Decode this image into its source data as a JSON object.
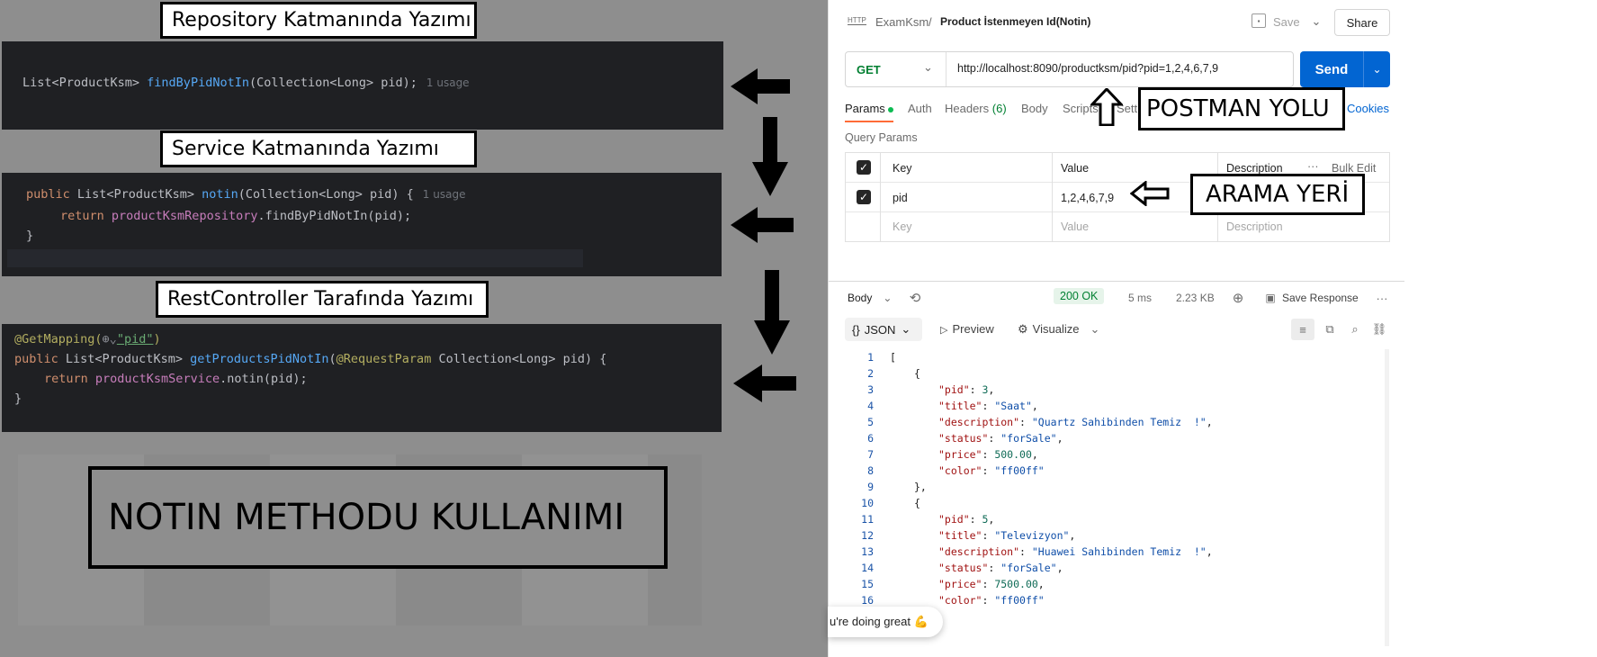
{
  "annotations": {
    "repository_label": "Repository Katmanında Yazımı",
    "service_label": "Service Katmanında Yazımı",
    "controller_label": "RestController Tarafında Yazımı",
    "big_title": "NOTIN METHODU KULLANIMI",
    "postman_yolu": "POSTMAN YOLU",
    "arama_yeri": "ARAMA YERİ"
  },
  "code": {
    "repository": {
      "line1_type": "List<ProductKsm> ",
      "line1_fn": "findByPidNotIn",
      "line1_rest": "(Collection<Long> pid);",
      "usage": "1 usage"
    },
    "service": {
      "line1_kw": "public ",
      "line1_type": "List<ProductKsm> ",
      "line1_fn": "notin",
      "line1_rest": "(Collection<Long> pid) {",
      "usage": "1 usage",
      "line2_kw": "return ",
      "line2_field": "productKsmRepository",
      "line2_rest": ".findByPidNotIn(pid);",
      "line3": "}"
    },
    "controller": {
      "line1_ann": "@GetMapping(",
      "line1_globe": "⊕⌄",
      "line1_str": "\"pid\"",
      "line1_close": ")",
      "line2_kw": "public ",
      "line2_type": "List<ProductKsm> ",
      "line2_fn": "getProductsPidNotIn",
      "line2_mid": "(",
      "line2_ann": "@RequestParam",
      "line2_rest": " Collection<Long> pid) {",
      "line3_kw": "return ",
      "line3_field": "productKsmService",
      "line3_rest": ".notin(pid);",
      "line4": "}"
    }
  },
  "postman": {
    "breadcrumb_icon": "HTTP",
    "breadcrumb_collection": "ExamKsm",
    "breadcrumb_sep": "/",
    "breadcrumb_request": "Product İstenmeyen Id(Notin)",
    "save_label": "Save",
    "share_label": "Share",
    "method": "GET",
    "url": "http://localhost:8090/productksm/pid?pid=1,2,4,6,7,9",
    "send_label": "Send",
    "tabs": {
      "params": "Params",
      "auth": "Auth",
      "headers": "Headers",
      "headers_count": "(6)",
      "body": "Body",
      "scripts": "Scripts",
      "settings": "Settings",
      "cookies": "Cookies"
    },
    "query_params_title": "Query Params",
    "table": {
      "col_key": "Key",
      "col_value": "Value",
      "col_description": "Description",
      "bulk_edit": "Bulk Edit",
      "row_key": "pid",
      "row_value": "1,2,4,6,7,9",
      "placeholder_key": "Key",
      "placeholder_value": "Value",
      "placeholder_description": "Description"
    },
    "response": {
      "body_label": "Body",
      "status": "200 OK",
      "time": "5 ms",
      "size": "2.23 KB",
      "save_response": "Save Response",
      "format": "JSON",
      "preview": "Preview",
      "visualize": "Visualize"
    },
    "json_lines": [
      {
        "n": "1",
        "indent": 0,
        "text": "["
      },
      {
        "n": "2",
        "indent": 1,
        "text": "{"
      },
      {
        "n": "3",
        "indent": 2,
        "key": "\"pid\"",
        "num": "3"
      },
      {
        "n": "4",
        "indent": 2,
        "key": "\"title\"",
        "str": "\"Saat\""
      },
      {
        "n": "5",
        "indent": 2,
        "key": "\"description\"",
        "str": "\"Quartz Sahibinden Temiz  !\""
      },
      {
        "n": "6",
        "indent": 2,
        "key": "\"status\"",
        "str": "\"forSale\""
      },
      {
        "n": "7",
        "indent": 2,
        "key": "\"price\"",
        "num": "500.00"
      },
      {
        "n": "8",
        "indent": 2,
        "key": "\"color\"",
        "str": "\"ff00ff\"",
        "last": true
      },
      {
        "n": "9",
        "indent": 1,
        "text": "},"
      },
      {
        "n": "10",
        "indent": 1,
        "text": "{"
      },
      {
        "n": "11",
        "indent": 2,
        "key": "\"pid\"",
        "num": "5"
      },
      {
        "n": "12",
        "indent": 2,
        "key": "\"title\"",
        "str": "\"Televizyon\""
      },
      {
        "n": "13",
        "indent": 2,
        "key": "\"description\"",
        "str": "\"Huawei Sahibinden Temiz  !\""
      },
      {
        "n": "14",
        "indent": 2,
        "key": "\"status\"",
        "str": "\"forSale\""
      },
      {
        "n": "15",
        "indent": 2,
        "key": "\"price\"",
        "num": "7500.00"
      },
      {
        "n": "16",
        "indent": 2,
        "key": "\"color\"",
        "str": "\"ff00ff\"",
        "last": true
      }
    ],
    "toast": "u're doing great 💪"
  }
}
